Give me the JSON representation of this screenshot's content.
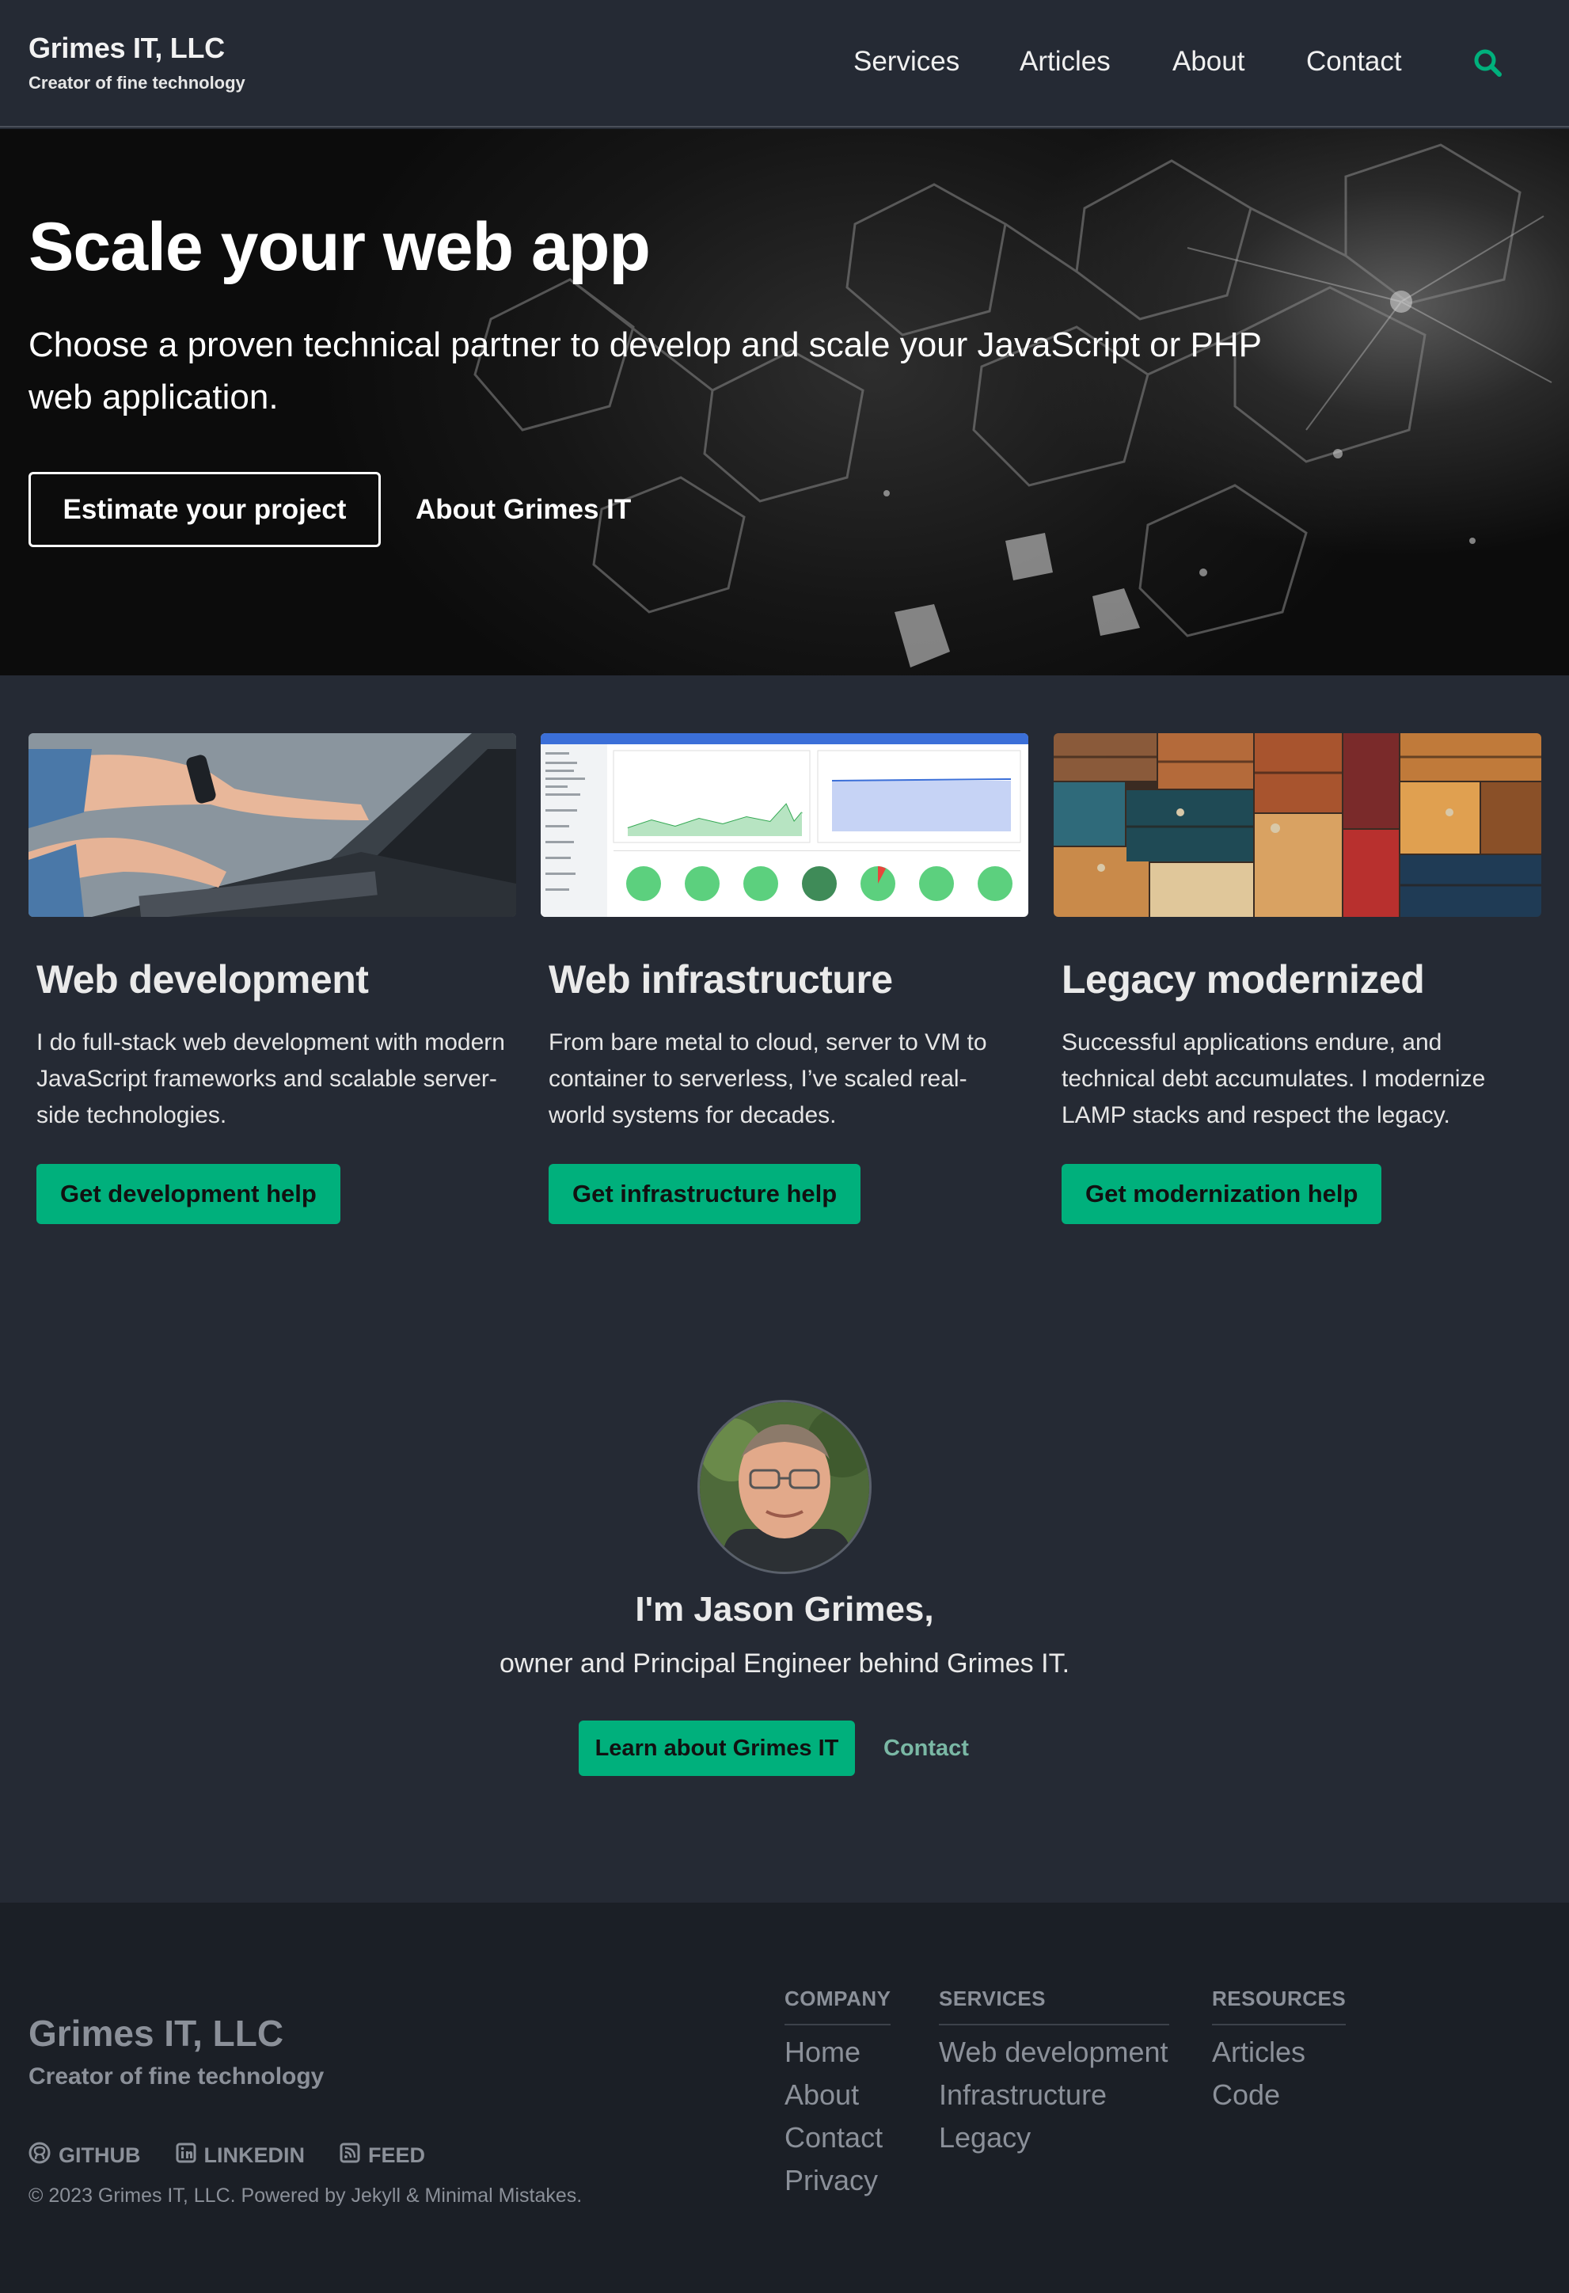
{
  "header": {
    "title": "Grimes IT, LLC",
    "subtitle": "Creator of fine technology",
    "nav": [
      "Services",
      "Articles",
      "About",
      "Contact"
    ],
    "search_icon": "search-icon"
  },
  "hero": {
    "title": "Scale your web app",
    "lead": "Choose a proven technical partner to develop and scale your JavaScript or PHP web application.",
    "primary_button": "Estimate your project",
    "secondary_link": "About Grimes IT"
  },
  "features": [
    {
      "title": "Web development",
      "body": "I do full-stack web development with modern JavaScript frameworks and scalable server-side technologies.",
      "button": "Get development help"
    },
    {
      "title": "Web infrastructure",
      "body": "From bare metal to cloud, server to VM to container to serverless, I’ve scaled real-world systems for decades.",
      "button": "Get infrastructure help"
    },
    {
      "title": "Legacy modernized",
      "body": "Successful applications endure, and technical debt accumulates. I modernize LAMP stacks and respect the legacy.",
      "button": "Get modernization help"
    }
  ],
  "author": {
    "name": "I'm Jason Grimes,",
    "role": "owner and Principal Engineer behind Grimes IT.",
    "learn_button": "Learn about Grimes IT",
    "contact_link": "Contact"
  },
  "footer": {
    "title": "Grimes IT, LLC",
    "subtitle": "Creator of fine technology",
    "social": [
      "GITHUB",
      "LINKEDIN",
      "FEED"
    ],
    "copyright": "© 2023 Grimes IT, LLC. Powered by Jekyll & Minimal Mistakes.",
    "columns": [
      {
        "heading": "COMPANY",
        "items": [
          "Home",
          "About",
          "Contact",
          "Privacy"
        ]
      },
      {
        "heading": "SERVICES",
        "items": [
          "Web development",
          "Infrastructure",
          "Legacy"
        ]
      },
      {
        "heading": "RESOURCES",
        "items": [
          "Articles",
          "Code"
        ]
      }
    ]
  },
  "colors": {
    "background": "#252a34",
    "accent": "#00b07c",
    "footer_background": "#1b1f26",
    "footer_text": "#8b9099"
  }
}
